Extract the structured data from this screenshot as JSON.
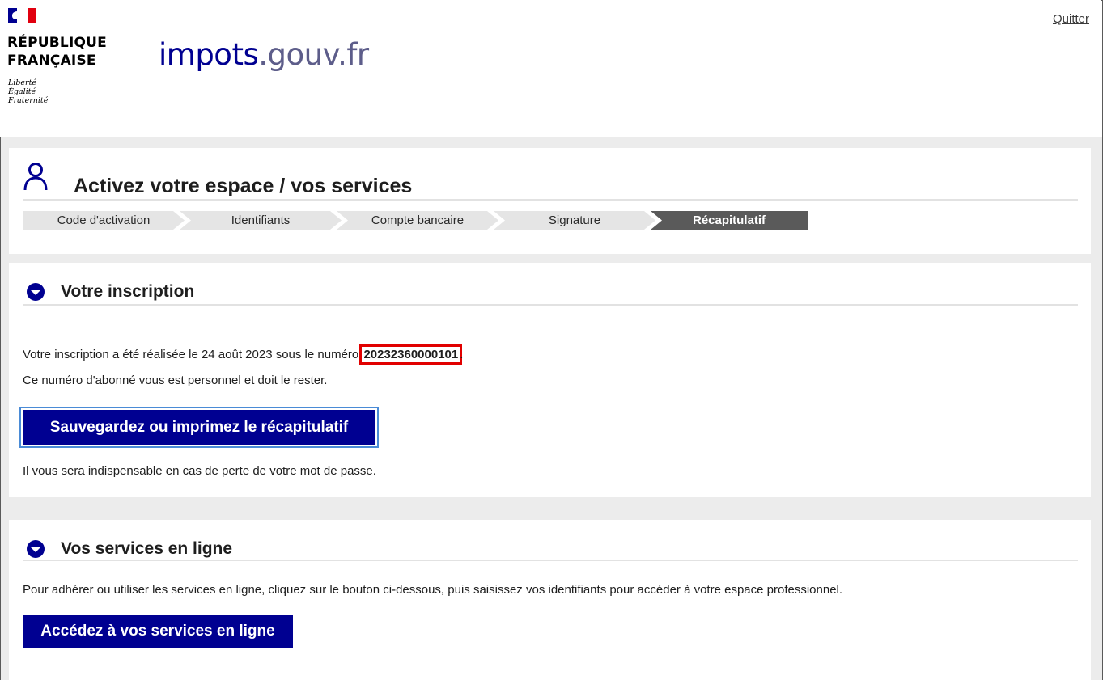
{
  "header": {
    "republic_line1": "RÉPUBLIQUE",
    "republic_line2": "FRANÇAISE",
    "motto_line1": "Liberté",
    "motto_line2": "Égalité",
    "motto_line3": "Fraternité",
    "site_logo_main": "impots",
    "site_logo_sub": ".gouv.fr",
    "quit_label": "Quitter"
  },
  "page": {
    "title": "Activez votre espace / vos services",
    "steps": [
      {
        "label": "Code d'activation",
        "active": false
      },
      {
        "label": "Identifiants",
        "active": false
      },
      {
        "label": "Compte bancaire",
        "active": false
      },
      {
        "label": "Signature",
        "active": false
      },
      {
        "label": "Récapitulatif",
        "active": true
      }
    ]
  },
  "inscription": {
    "heading": "Votre inscription",
    "line1_prefix": "Votre inscription a été réalisée le 24 août 2023 sous le numéro ",
    "subscriber_number": "20232360000101",
    "line1_suffix": ".",
    "line2": "Ce numéro d'abonné vous est personnel et doit le rester.",
    "save_button": "Sauvegardez ou imprimez le récapitulatif",
    "note": "Il vous sera indispensable en cas de perte de votre mot de passe."
  },
  "services": {
    "heading": "Vos services en ligne",
    "description": "Pour adhérer ou utiliser les services en ligne, cliquez sur le bouton ci-dessous, puis saisissez vos identifiants pour accéder à votre espace professionnel.",
    "access_button": "Accédez à vos services en ligne"
  },
  "colors": {
    "brand_blue": "#000091",
    "france_red": "#e1000f",
    "active_step": "#5a5a5a",
    "highlight_box": "#e10000"
  }
}
